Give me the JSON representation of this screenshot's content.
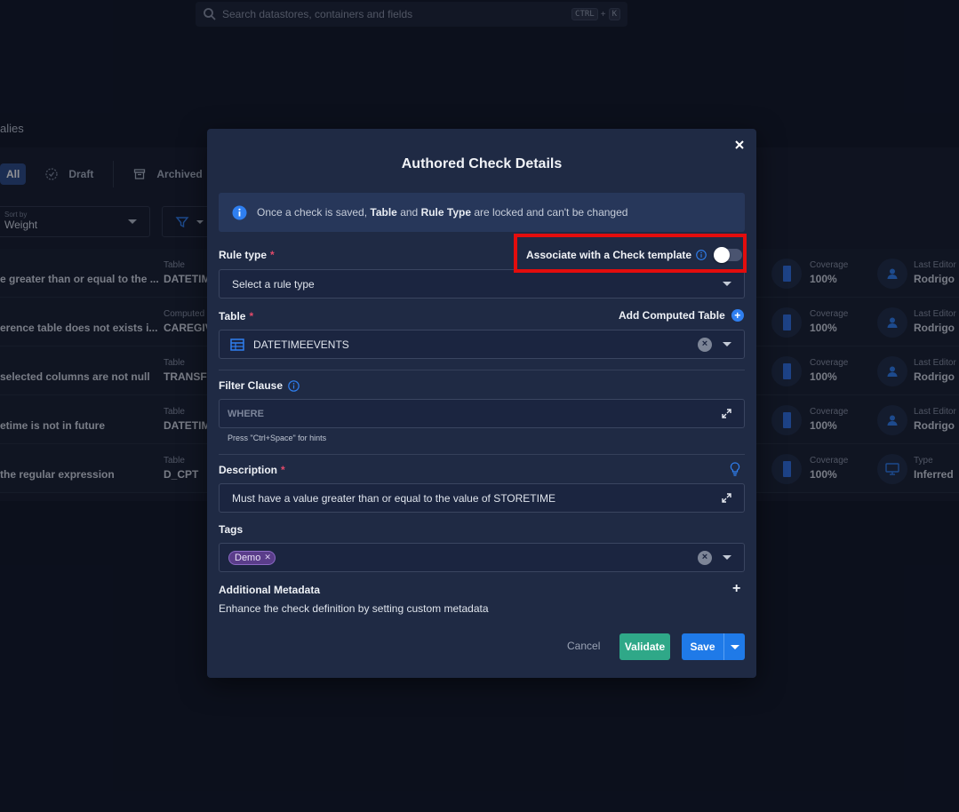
{
  "search": {
    "placeholder": "Search datastores, containers and fields",
    "key1": "CTRL",
    "plus": "+",
    "key2": "K"
  },
  "page": {
    "section_title": "alies"
  },
  "tabs": {
    "all": "All",
    "draft": "Draft",
    "archived": "Archived"
  },
  "sort": {
    "label": "Sort by",
    "value": "Weight"
  },
  "rows": [
    {
      "name": "e greater than or equal to the ...",
      "table_label": "Table",
      "table_value": "DATETIM",
      "cov_label": "Coverage",
      "cov_value": "100%",
      "ed_label": "Last Editor",
      "ed_value": "Rodrigo",
      "ed_icon": "person-icon"
    },
    {
      "name": "erence table does not exists i...",
      "table_label": "Computed",
      "table_value": "CAREGIV",
      "cov_label": "Coverage",
      "cov_value": "100%",
      "ed_label": "Last Editor",
      "ed_value": "Rodrigo",
      "ed_icon": "person-icon"
    },
    {
      "name": "selected columns are not null",
      "table_label": "Table",
      "table_value": "TRANSFE",
      "cov_label": "Coverage",
      "cov_value": "100%",
      "ed_label": "Last Editor",
      "ed_value": "Rodrigo",
      "ed_icon": "person-icon"
    },
    {
      "name": "etime is not in future",
      "table_label": "Table",
      "table_value": "DATETIM",
      "cov_label": "Coverage",
      "cov_value": "100%",
      "ed_label": "Last Editor",
      "ed_value": "Rodrigo",
      "ed_icon": "person-icon"
    },
    {
      "name": "the regular expression",
      "table_label": "Table",
      "table_value": "D_CPT",
      "cov_label": "Coverage",
      "cov_value": "100%",
      "ed_label": "Type",
      "ed_value": "Inferred",
      "ed_icon": "monitor-icon"
    }
  ],
  "modal": {
    "title": "Authored Check Details",
    "info": {
      "pre": "Once a check is saved, ",
      "b1": "Table",
      "mid": " and ",
      "b2": "Rule Type",
      "post": " are locked and can't be changed"
    },
    "rule_type": {
      "label": "Rule type",
      "required": "*",
      "placeholder": "Select a rule type"
    },
    "template": {
      "label": "Associate with a Check template",
      "enabled": false
    },
    "table": {
      "label": "Table",
      "required": "*",
      "value": "DATETIMEEVENTS",
      "add_computed": "Add Computed Table"
    },
    "filter": {
      "label": "Filter Clause",
      "placeholder": "WHERE",
      "hint": "Press \"Ctrl+Space\" for hints"
    },
    "description": {
      "label": "Description",
      "required": "*",
      "value": "Must have a value greater than or equal to the value of STORETIME"
    },
    "tags": {
      "label": "Tags",
      "items": [
        "Demo"
      ]
    },
    "metadata": {
      "label": "Additional Metadata",
      "desc": "Enhance the check definition by setting custom metadata",
      "add": "+"
    },
    "buttons": {
      "cancel": "Cancel",
      "validate": "Validate",
      "save": "Save"
    }
  },
  "colors": {
    "accent": "#1f7ae8",
    "validate": "#2fa888",
    "highlight": "#e30d0d",
    "required": "#e24a6a"
  }
}
